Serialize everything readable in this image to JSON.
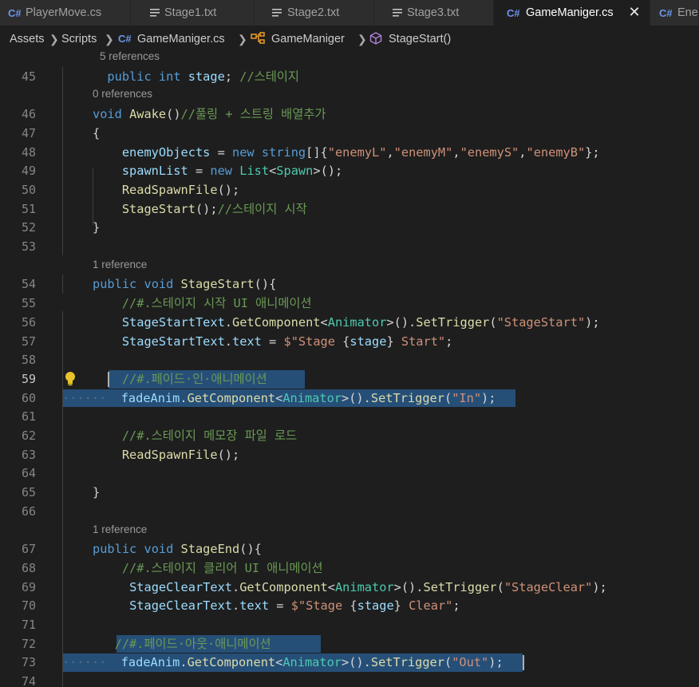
{
  "tabs": [
    {
      "label": "PlayerMove.cs",
      "icon": "csharp-icon",
      "active": false
    },
    {
      "label": "Stage1.txt",
      "icon": "text-file-icon",
      "active": false
    },
    {
      "label": "Stage2.txt",
      "icon": "text-file-icon",
      "active": false
    },
    {
      "label": "Stage3.txt",
      "icon": "text-file-icon",
      "active": false
    },
    {
      "label": "GameManiger.cs",
      "icon": "csharp-icon",
      "active": true,
      "close": "✕"
    },
    {
      "label": "Ene",
      "icon": "csharp-icon",
      "active": false
    }
  ],
  "breadcrumb": {
    "items": [
      "Assets",
      "Scripts",
      "GameManiger.cs",
      "GameManiger",
      "StageStart()"
    ]
  },
  "editor": {
    "lines": [
      {
        "type": "lens",
        "text": "5 references"
      },
      {
        "n": "45",
        "code": [
          [
            "p",
            "  "
          ],
          [
            "k",
            "public"
          ],
          [
            "p",
            " "
          ],
          [
            "k",
            "int"
          ],
          [
            "p",
            " "
          ],
          [
            "v",
            "stage"
          ],
          [
            "p",
            "; "
          ],
          [
            "c",
            "//스테이지"
          ]
        ]
      },
      {
        "type": "lens",
        "text": "0 references"
      },
      {
        "n": "46",
        "code": [
          [
            "k",
            "void"
          ],
          [
            "p",
            " "
          ],
          [
            "f",
            "Awake"
          ],
          [
            "p",
            "()"
          ],
          [
            "c",
            "//풀링 + 스트링 배열추가"
          ]
        ]
      },
      {
        "n": "47",
        "code": [
          [
            "p",
            "{"
          ]
        ]
      },
      {
        "n": "48",
        "code": [
          [
            "p",
            "    "
          ],
          [
            "v",
            "enemyObjects"
          ],
          [
            "p",
            " = "
          ],
          [
            "k",
            "new"
          ],
          [
            "p",
            " "
          ],
          [
            "k",
            "string"
          ],
          [
            "p",
            "[]{"
          ],
          [
            "s",
            "\"enemyL\""
          ],
          [
            "p",
            ","
          ],
          [
            "s",
            "\"enemyM\""
          ],
          [
            "p",
            ","
          ],
          [
            "s",
            "\"enemyS\""
          ],
          [
            "p",
            ","
          ],
          [
            "s",
            "\"enemyB\""
          ],
          [
            "p",
            "};"
          ]
        ]
      },
      {
        "n": "49",
        "code": [
          [
            "p",
            "    "
          ],
          [
            "v",
            "spawnList"
          ],
          [
            "p",
            " = "
          ],
          [
            "k",
            "new"
          ],
          [
            "p",
            " "
          ],
          [
            "t",
            "List"
          ],
          [
            "p",
            "<"
          ],
          [
            "t",
            "Spawn"
          ],
          [
            "p",
            ">();"
          ]
        ]
      },
      {
        "n": "50",
        "code": [
          [
            "p",
            "    "
          ],
          [
            "f",
            "ReadSpawnFile"
          ],
          [
            "p",
            "();"
          ]
        ]
      },
      {
        "n": "51",
        "code": [
          [
            "p",
            "    "
          ],
          [
            "f",
            "StageStart"
          ],
          [
            "p",
            "();"
          ],
          [
            "c",
            "//스테이지 시작"
          ]
        ]
      },
      {
        "n": "52",
        "code": [
          [
            "p",
            "}"
          ]
        ]
      },
      {
        "n": "53",
        "code": []
      },
      {
        "type": "lens",
        "text": "1 reference"
      },
      {
        "n": "54",
        "code": [
          [
            "k",
            "public"
          ],
          [
            "p",
            " "
          ],
          [
            "k",
            "void"
          ],
          [
            "p",
            " "
          ],
          [
            "f",
            "StageStart"
          ],
          [
            "p",
            "(){"
          ]
        ]
      },
      {
        "n": "55",
        "code": [
          [
            "p",
            "    "
          ],
          [
            "c",
            "//#.스테이지 시작 UI 애니메이션"
          ]
        ]
      },
      {
        "n": "56",
        "code": [
          [
            "p",
            "    "
          ],
          [
            "v",
            "StageStartText"
          ],
          [
            "p",
            "."
          ],
          [
            "f",
            "GetComponent"
          ],
          [
            "p",
            "<"
          ],
          [
            "t",
            "Animator"
          ],
          [
            "p",
            ">()."
          ],
          [
            "f",
            "SetTrigger"
          ],
          [
            "p",
            "("
          ],
          [
            "s",
            "\"StageStart\""
          ],
          [
            "p",
            ");"
          ]
        ]
      },
      {
        "n": "57",
        "code": [
          [
            "p",
            "    "
          ],
          [
            "v",
            "StageStartText"
          ],
          [
            "p",
            "."
          ],
          [
            "v",
            "text"
          ],
          [
            "p",
            " = "
          ],
          [
            "s",
            "$\"Stage "
          ],
          [
            "p",
            "{"
          ],
          [
            "v",
            "stage"
          ],
          [
            "p",
            "}"
          ],
          [
            "s",
            " Start\""
          ],
          [
            "p",
            ";"
          ]
        ]
      },
      {
        "n": "58",
        "code": []
      },
      {
        "n": "59",
        "current": true,
        "code": [
          [
            "p",
            "    "
          ],
          [
            "c",
            "//#.페이드·인·애니메이션"
          ]
        ]
      },
      {
        "n": "60",
        "code": [
          [
            "ws",
            "······"
          ],
          [
            "p",
            "  "
          ],
          [
            "v",
            "fadeAnim"
          ],
          [
            "p",
            "."
          ],
          [
            "f",
            "GetComponent"
          ],
          [
            "p",
            "<"
          ],
          [
            "t",
            "Animator"
          ],
          [
            "p",
            ">()."
          ],
          [
            "f",
            "SetTrigger"
          ],
          [
            "p",
            "("
          ],
          [
            "s",
            "\"In\""
          ],
          [
            "p",
            ");"
          ]
        ]
      },
      {
        "n": "61",
        "code": []
      },
      {
        "n": "62",
        "code": [
          [
            "p",
            "    "
          ],
          [
            "c",
            "//#.스테이지 메모장 파일 로드"
          ]
        ]
      },
      {
        "n": "63",
        "code": [
          [
            "p",
            "    "
          ],
          [
            "f",
            "ReadSpawnFile"
          ],
          [
            "p",
            "();"
          ]
        ]
      },
      {
        "n": "64",
        "code": []
      },
      {
        "n": "65",
        "code": [
          [
            "p",
            "}"
          ]
        ]
      },
      {
        "n": "66",
        "code": []
      },
      {
        "type": "lens",
        "text": "1 reference"
      },
      {
        "n": "67",
        "code": [
          [
            "k",
            "public"
          ],
          [
            "p",
            " "
          ],
          [
            "k",
            "void"
          ],
          [
            "p",
            " "
          ],
          [
            "f",
            "StageEnd"
          ],
          [
            "p",
            "(){"
          ]
        ]
      },
      {
        "n": "68",
        "code": [
          [
            "p",
            "    "
          ],
          [
            "c",
            "//#.스테이지 클리어 UI 애니메이션"
          ]
        ]
      },
      {
        "n": "69",
        "code": [
          [
            "p",
            "     "
          ],
          [
            "v",
            "StageClearText"
          ],
          [
            "p",
            "."
          ],
          [
            "f",
            "GetComponent"
          ],
          [
            "p",
            "<"
          ],
          [
            "t",
            "Animator"
          ],
          [
            "p",
            ">()."
          ],
          [
            "f",
            "SetTrigger"
          ],
          [
            "p",
            "("
          ],
          [
            "s",
            "\"StageClear\""
          ],
          [
            "p",
            ");"
          ]
        ]
      },
      {
        "n": "70",
        "code": [
          [
            "p",
            "     "
          ],
          [
            "v",
            "StageClearText"
          ],
          [
            "p",
            "."
          ],
          [
            "v",
            "text"
          ],
          [
            "p",
            " = "
          ],
          [
            "s",
            "$\"Stage "
          ],
          [
            "p",
            "{"
          ],
          [
            "v",
            "stage"
          ],
          [
            "p",
            "}"
          ],
          [
            "s",
            " Clear\""
          ],
          [
            "p",
            ";"
          ]
        ]
      },
      {
        "n": "71",
        "code": []
      },
      {
        "n": "72",
        "code": [
          [
            "p",
            "   "
          ],
          [
            "c",
            "//#.페이드·아웃·애니메이션"
          ]
        ]
      },
      {
        "n": "73",
        "code": [
          [
            "ws",
            "······"
          ],
          [
            "p",
            "  "
          ],
          [
            "v",
            "fadeAnim"
          ],
          [
            "p",
            "."
          ],
          [
            "f",
            "GetComponent"
          ],
          [
            "p",
            "<"
          ],
          [
            "t",
            "Animator"
          ],
          [
            "p",
            ">()."
          ],
          [
            "f",
            "SetTrigger"
          ],
          [
            "p",
            "("
          ],
          [
            "s",
            "\"Out\""
          ],
          [
            "p",
            ");"
          ]
        ]
      },
      {
        "n": "74",
        "code": []
      }
    ]
  },
  "colors": {
    "editor_bg": "#1e1e1e",
    "tab_bg": "#2d2d2d",
    "selection": "#264f78",
    "keyword": "#569cd6",
    "function": "#dcdcaa",
    "variable": "#9cdcfe",
    "string": "#ce9178",
    "comment": "#6a9955",
    "type": "#4ec9b0",
    "csharp_icon": "#6c95eb",
    "bulb": "#e8c22a"
  }
}
